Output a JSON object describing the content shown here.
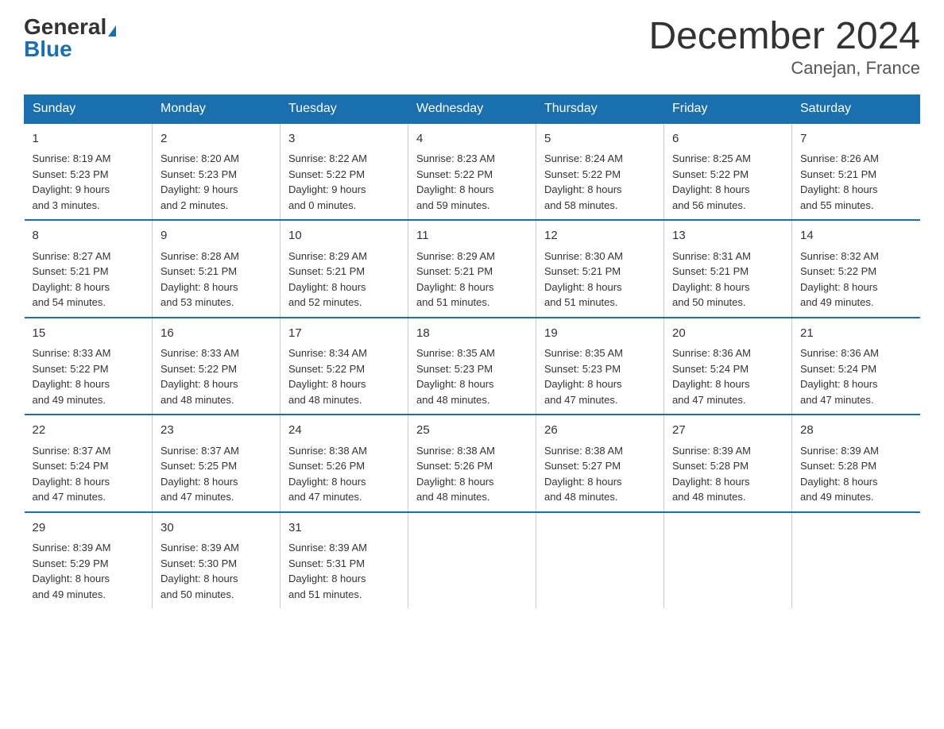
{
  "header": {
    "logo_general": "General",
    "logo_blue": "Blue",
    "month_title": "December 2024",
    "location": "Canejan, France"
  },
  "days_of_week": [
    "Sunday",
    "Monday",
    "Tuesday",
    "Wednesday",
    "Thursday",
    "Friday",
    "Saturday"
  ],
  "weeks": [
    [
      {
        "num": "1",
        "info": "Sunrise: 8:19 AM\nSunset: 5:23 PM\nDaylight: 9 hours\nand 3 minutes."
      },
      {
        "num": "2",
        "info": "Sunrise: 8:20 AM\nSunset: 5:23 PM\nDaylight: 9 hours\nand 2 minutes."
      },
      {
        "num": "3",
        "info": "Sunrise: 8:22 AM\nSunset: 5:22 PM\nDaylight: 9 hours\nand 0 minutes."
      },
      {
        "num": "4",
        "info": "Sunrise: 8:23 AM\nSunset: 5:22 PM\nDaylight: 8 hours\nand 59 minutes."
      },
      {
        "num": "5",
        "info": "Sunrise: 8:24 AM\nSunset: 5:22 PM\nDaylight: 8 hours\nand 58 minutes."
      },
      {
        "num": "6",
        "info": "Sunrise: 8:25 AM\nSunset: 5:22 PM\nDaylight: 8 hours\nand 56 minutes."
      },
      {
        "num": "7",
        "info": "Sunrise: 8:26 AM\nSunset: 5:21 PM\nDaylight: 8 hours\nand 55 minutes."
      }
    ],
    [
      {
        "num": "8",
        "info": "Sunrise: 8:27 AM\nSunset: 5:21 PM\nDaylight: 8 hours\nand 54 minutes."
      },
      {
        "num": "9",
        "info": "Sunrise: 8:28 AM\nSunset: 5:21 PM\nDaylight: 8 hours\nand 53 minutes."
      },
      {
        "num": "10",
        "info": "Sunrise: 8:29 AM\nSunset: 5:21 PM\nDaylight: 8 hours\nand 52 minutes."
      },
      {
        "num": "11",
        "info": "Sunrise: 8:29 AM\nSunset: 5:21 PM\nDaylight: 8 hours\nand 51 minutes."
      },
      {
        "num": "12",
        "info": "Sunrise: 8:30 AM\nSunset: 5:21 PM\nDaylight: 8 hours\nand 51 minutes."
      },
      {
        "num": "13",
        "info": "Sunrise: 8:31 AM\nSunset: 5:21 PM\nDaylight: 8 hours\nand 50 minutes."
      },
      {
        "num": "14",
        "info": "Sunrise: 8:32 AM\nSunset: 5:22 PM\nDaylight: 8 hours\nand 49 minutes."
      }
    ],
    [
      {
        "num": "15",
        "info": "Sunrise: 8:33 AM\nSunset: 5:22 PM\nDaylight: 8 hours\nand 49 minutes."
      },
      {
        "num": "16",
        "info": "Sunrise: 8:33 AM\nSunset: 5:22 PM\nDaylight: 8 hours\nand 48 minutes."
      },
      {
        "num": "17",
        "info": "Sunrise: 8:34 AM\nSunset: 5:22 PM\nDaylight: 8 hours\nand 48 minutes."
      },
      {
        "num": "18",
        "info": "Sunrise: 8:35 AM\nSunset: 5:23 PM\nDaylight: 8 hours\nand 48 minutes."
      },
      {
        "num": "19",
        "info": "Sunrise: 8:35 AM\nSunset: 5:23 PM\nDaylight: 8 hours\nand 47 minutes."
      },
      {
        "num": "20",
        "info": "Sunrise: 8:36 AM\nSunset: 5:24 PM\nDaylight: 8 hours\nand 47 minutes."
      },
      {
        "num": "21",
        "info": "Sunrise: 8:36 AM\nSunset: 5:24 PM\nDaylight: 8 hours\nand 47 minutes."
      }
    ],
    [
      {
        "num": "22",
        "info": "Sunrise: 8:37 AM\nSunset: 5:24 PM\nDaylight: 8 hours\nand 47 minutes."
      },
      {
        "num": "23",
        "info": "Sunrise: 8:37 AM\nSunset: 5:25 PM\nDaylight: 8 hours\nand 47 minutes."
      },
      {
        "num": "24",
        "info": "Sunrise: 8:38 AM\nSunset: 5:26 PM\nDaylight: 8 hours\nand 47 minutes."
      },
      {
        "num": "25",
        "info": "Sunrise: 8:38 AM\nSunset: 5:26 PM\nDaylight: 8 hours\nand 48 minutes."
      },
      {
        "num": "26",
        "info": "Sunrise: 8:38 AM\nSunset: 5:27 PM\nDaylight: 8 hours\nand 48 minutes."
      },
      {
        "num": "27",
        "info": "Sunrise: 8:39 AM\nSunset: 5:28 PM\nDaylight: 8 hours\nand 48 minutes."
      },
      {
        "num": "28",
        "info": "Sunrise: 8:39 AM\nSunset: 5:28 PM\nDaylight: 8 hours\nand 49 minutes."
      }
    ],
    [
      {
        "num": "29",
        "info": "Sunrise: 8:39 AM\nSunset: 5:29 PM\nDaylight: 8 hours\nand 49 minutes."
      },
      {
        "num": "30",
        "info": "Sunrise: 8:39 AM\nSunset: 5:30 PM\nDaylight: 8 hours\nand 50 minutes."
      },
      {
        "num": "31",
        "info": "Sunrise: 8:39 AM\nSunset: 5:31 PM\nDaylight: 8 hours\nand 51 minutes."
      },
      {
        "num": "",
        "info": ""
      },
      {
        "num": "",
        "info": ""
      },
      {
        "num": "",
        "info": ""
      },
      {
        "num": "",
        "info": ""
      }
    ]
  ]
}
